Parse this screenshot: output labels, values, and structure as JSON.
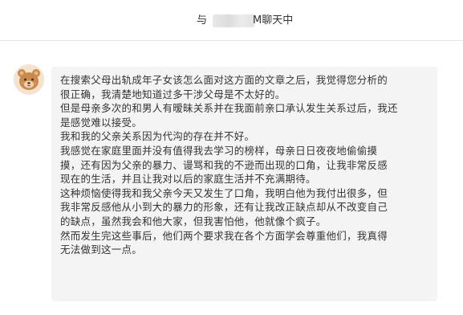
{
  "chat": {
    "title_prefix": "与",
    "title_suffix": "聊天中",
    "title_mid_visible": "M"
  },
  "message": {
    "lines": [
      "在搜索父母出轨成年子女该怎么面对这方面的文章之后，我觉得您分析的",
      "很正确，我清楚地知道过多干涉父母是不太好的。",
      "但是母亲多次的和男人有暧昧关系并在我面前亲口承认发生关系过后，我还",
      "是感觉难以接受。",
      "我和我的父亲关系因为代沟的存在并不好。",
      "我感觉在家庭里面并没有值得我去学习的榜样，母亲日日夜夜地偷偷摸",
      "摸，还有因为父亲的暴力、谩骂和我的不逊而出现的口角，让我非常反感",
      "现在的生活，并且让我对以后的家庭生活并不充满期待。",
      "这种烦恼使得我和我父亲今天又发生了口角，我明白他为我付出很多，但",
      "我非常反感他从小到大的暴力的形象，还有让我改正缺点却从不改变自己",
      "的缺点，虽然我会和他大家，但我害怕他，他就像个疯子。",
      "然而发生完这些事后，他们两个要求我在各个方面学会尊重他们，我真得",
      "无法做到这一点。"
    ]
  },
  "colors": {
    "bubble_bg": "#f4f4f4",
    "avatar_bg": "#f3e3cf",
    "bear_fur": "#c98a4b",
    "text": "#333333"
  },
  "icons": {
    "avatar": "bear-avatar-icon"
  }
}
